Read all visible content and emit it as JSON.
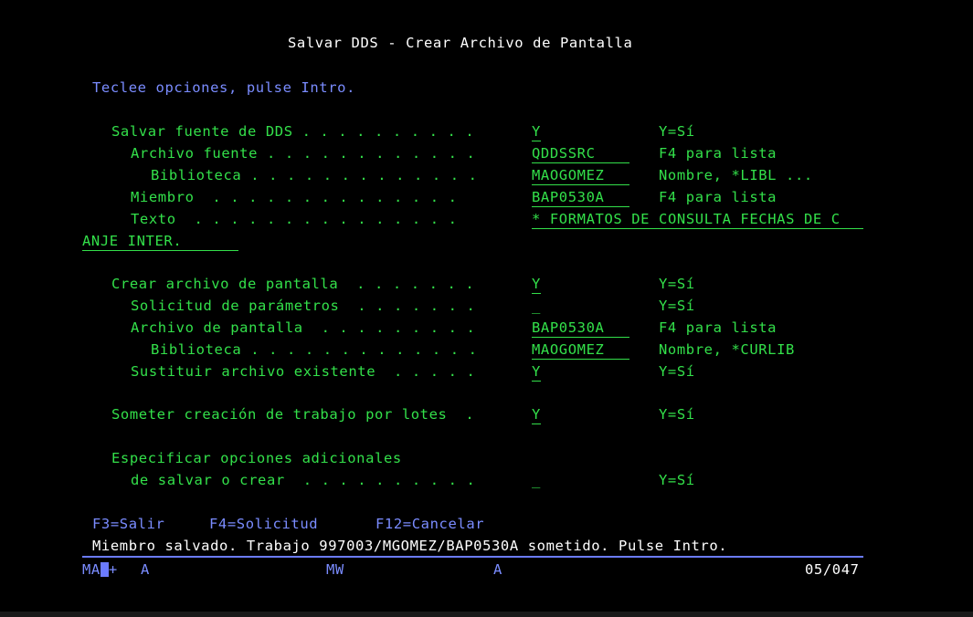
{
  "title": "Salvar DDS - Crear Archivo de Pantalla",
  "instructions": "Teclee opciones, pulse Intro.",
  "section1": {
    "salvar_fuente": {
      "label": "Salvar fuente de DDS . . . . . . . . . .",
      "value": "Y",
      "hint": "Y=Sí"
    },
    "archivo_fuente": {
      "label": "Archivo fuente . . . . . . . . . . . .",
      "value": "QDDSSRC",
      "hint": "F4 para lista"
    },
    "biblioteca": {
      "label": "Biblioteca . . . . . . . . . . . . .",
      "value": "MAOGOMEZ",
      "hint": "Nombre, *LIBL ..."
    },
    "miembro": {
      "label": "Miembro  . . . . . . . . . . . . . .",
      "value": "BAP0530A",
      "hint": "F4 para lista"
    },
    "texto": {
      "label": "Texto  . . . . . . . . . . . . . . .",
      "value": "* FORMATOS DE CONSULTA FECHAS DE C",
      "value_cont": "ANJE INTER."
    }
  },
  "section2": {
    "crear_archivo": {
      "label": "Crear archivo de pantalla  . . . . . . .",
      "value": "Y",
      "hint": "Y=Sí"
    },
    "solicitud": {
      "label": "Solicitud de parámetros  . . . . . . .",
      "value": "_",
      "hint": "Y=Sí"
    },
    "archivo_pantalla": {
      "label": "Archivo de pantalla  . . . . . . . . .",
      "value": "BAP0530A",
      "hint": "F4 para lista"
    },
    "biblioteca": {
      "label": "Biblioteca . . . . . . . . . . . . .",
      "value": "MAOGOMEZ",
      "hint": "Nombre, *CURLIB"
    },
    "sustituir": {
      "label": "Sustituir archivo existente  . . . . .",
      "value": "Y",
      "hint": "Y=Sí"
    }
  },
  "section3": {
    "someter": {
      "label": "Someter creación de trabajo por lotes  .",
      "value": "Y",
      "hint": "Y=Sí"
    }
  },
  "section4": {
    "especificar_line1": "Especificar opciones adicionales",
    "especificar_line2": "de salvar o crear  . . . . . . . . . .",
    "value": "_",
    "hint": "Y=Sí"
  },
  "function_keys": {
    "f3": "F3=Salir",
    "f4": "F4=Solicitud",
    "f12": "F12=Cancelar"
  },
  "message": "Miembro salvado. Trabajo 997003/MGOMEZ/BAP0530A sometido. Pulse Intro.",
  "status_bar": {
    "ma": "MA",
    "plus": "+",
    "a1": "A",
    "mw": "MW",
    "a2": "A",
    "cursor_pos": "05/047"
  },
  "colors": {
    "background": "#000000",
    "title": "#ffffff",
    "instructions": "#7a8cff",
    "fields": "#33e04a",
    "separator": "#6b7bff"
  }
}
